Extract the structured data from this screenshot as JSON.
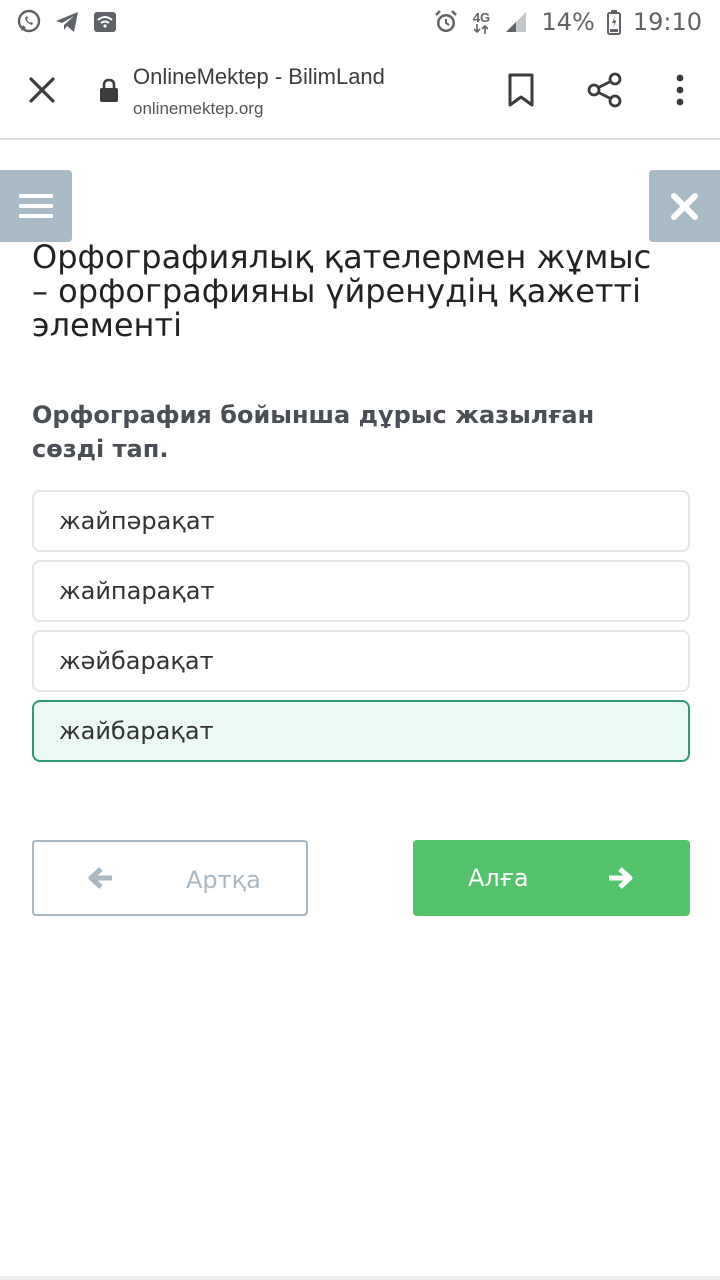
{
  "status_bar": {
    "left_icons": [
      "whatsapp-icon",
      "telegram-icon",
      "wifi-call-icon"
    ],
    "right_icons": [
      "alarm-icon",
      "network-4g-icon",
      "signal-icon",
      "battery-icon"
    ],
    "network": "4G",
    "battery": "14%",
    "time": "19:10"
  },
  "browser": {
    "title": "OnlineMektep - BilimLand",
    "url": "onlinemektep.org",
    "icons": [
      "close-icon",
      "lock-icon",
      "bookmark-icon",
      "share-icon",
      "more-icon"
    ]
  },
  "lesson": {
    "title": "Орфографиялық қателермен жұмыс – орфографияны үйренудің қажетті элементі",
    "question": "Орфография бойынша дұрыс жазылған сөзді тап.",
    "answers": [
      {
        "label": "жайпәрақат",
        "selected": false
      },
      {
        "label": "жайпарақат",
        "selected": false
      },
      {
        "label": "жәйбарақат",
        "selected": false
      },
      {
        "label": "жайбарақат",
        "selected": true
      }
    ]
  },
  "nav": {
    "back_label": "Артқа",
    "next_label": "Алға"
  },
  "colors": {
    "accent_green": "#52c36b",
    "selected_border": "#2e9a7c",
    "selected_bg": "#edf9f3",
    "side_button": "#a7bac5"
  }
}
